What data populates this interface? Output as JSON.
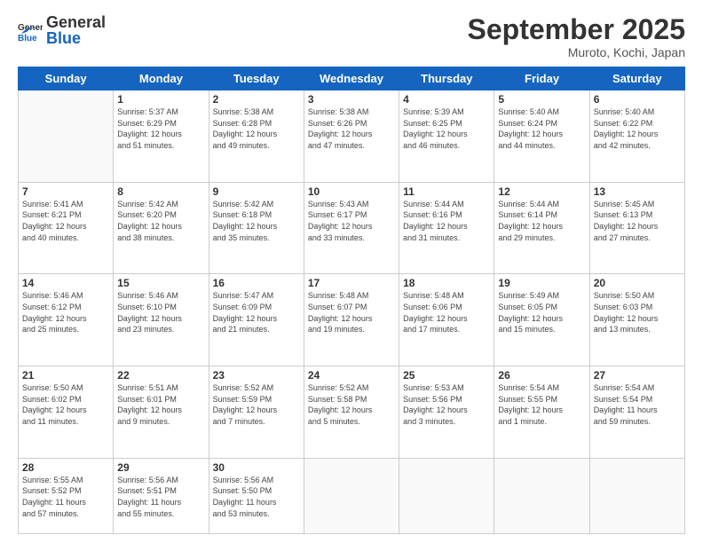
{
  "header": {
    "logo_general": "General",
    "logo_blue": "Blue",
    "month_title": "September 2025",
    "location": "Muroto, Kochi, Japan"
  },
  "weekdays": [
    "Sunday",
    "Monday",
    "Tuesday",
    "Wednesday",
    "Thursday",
    "Friday",
    "Saturday"
  ],
  "weeks": [
    [
      {
        "day": "",
        "info": ""
      },
      {
        "day": "1",
        "info": "Sunrise: 5:37 AM\nSunset: 6:29 PM\nDaylight: 12 hours\nand 51 minutes."
      },
      {
        "day": "2",
        "info": "Sunrise: 5:38 AM\nSunset: 6:28 PM\nDaylight: 12 hours\nand 49 minutes."
      },
      {
        "day": "3",
        "info": "Sunrise: 5:38 AM\nSunset: 6:26 PM\nDaylight: 12 hours\nand 47 minutes."
      },
      {
        "day": "4",
        "info": "Sunrise: 5:39 AM\nSunset: 6:25 PM\nDaylight: 12 hours\nand 46 minutes."
      },
      {
        "day": "5",
        "info": "Sunrise: 5:40 AM\nSunset: 6:24 PM\nDaylight: 12 hours\nand 44 minutes."
      },
      {
        "day": "6",
        "info": "Sunrise: 5:40 AM\nSunset: 6:22 PM\nDaylight: 12 hours\nand 42 minutes."
      }
    ],
    [
      {
        "day": "7",
        "info": "Sunrise: 5:41 AM\nSunset: 6:21 PM\nDaylight: 12 hours\nand 40 minutes."
      },
      {
        "day": "8",
        "info": "Sunrise: 5:42 AM\nSunset: 6:20 PM\nDaylight: 12 hours\nand 38 minutes."
      },
      {
        "day": "9",
        "info": "Sunrise: 5:42 AM\nSunset: 6:18 PM\nDaylight: 12 hours\nand 35 minutes."
      },
      {
        "day": "10",
        "info": "Sunrise: 5:43 AM\nSunset: 6:17 PM\nDaylight: 12 hours\nand 33 minutes."
      },
      {
        "day": "11",
        "info": "Sunrise: 5:44 AM\nSunset: 6:16 PM\nDaylight: 12 hours\nand 31 minutes."
      },
      {
        "day": "12",
        "info": "Sunrise: 5:44 AM\nSunset: 6:14 PM\nDaylight: 12 hours\nand 29 minutes."
      },
      {
        "day": "13",
        "info": "Sunrise: 5:45 AM\nSunset: 6:13 PM\nDaylight: 12 hours\nand 27 minutes."
      }
    ],
    [
      {
        "day": "14",
        "info": "Sunrise: 5:46 AM\nSunset: 6:12 PM\nDaylight: 12 hours\nand 25 minutes."
      },
      {
        "day": "15",
        "info": "Sunrise: 5:46 AM\nSunset: 6:10 PM\nDaylight: 12 hours\nand 23 minutes."
      },
      {
        "day": "16",
        "info": "Sunrise: 5:47 AM\nSunset: 6:09 PM\nDaylight: 12 hours\nand 21 minutes."
      },
      {
        "day": "17",
        "info": "Sunrise: 5:48 AM\nSunset: 6:07 PM\nDaylight: 12 hours\nand 19 minutes."
      },
      {
        "day": "18",
        "info": "Sunrise: 5:48 AM\nSunset: 6:06 PM\nDaylight: 12 hours\nand 17 minutes."
      },
      {
        "day": "19",
        "info": "Sunrise: 5:49 AM\nSunset: 6:05 PM\nDaylight: 12 hours\nand 15 minutes."
      },
      {
        "day": "20",
        "info": "Sunrise: 5:50 AM\nSunset: 6:03 PM\nDaylight: 12 hours\nand 13 minutes."
      }
    ],
    [
      {
        "day": "21",
        "info": "Sunrise: 5:50 AM\nSunset: 6:02 PM\nDaylight: 12 hours\nand 11 minutes."
      },
      {
        "day": "22",
        "info": "Sunrise: 5:51 AM\nSunset: 6:01 PM\nDaylight: 12 hours\nand 9 minutes."
      },
      {
        "day": "23",
        "info": "Sunrise: 5:52 AM\nSunset: 5:59 PM\nDaylight: 12 hours\nand 7 minutes."
      },
      {
        "day": "24",
        "info": "Sunrise: 5:52 AM\nSunset: 5:58 PM\nDaylight: 12 hours\nand 5 minutes."
      },
      {
        "day": "25",
        "info": "Sunrise: 5:53 AM\nSunset: 5:56 PM\nDaylight: 12 hours\nand 3 minutes."
      },
      {
        "day": "26",
        "info": "Sunrise: 5:54 AM\nSunset: 5:55 PM\nDaylight: 12 hours\nand 1 minute."
      },
      {
        "day": "27",
        "info": "Sunrise: 5:54 AM\nSunset: 5:54 PM\nDaylight: 11 hours\nand 59 minutes."
      }
    ],
    [
      {
        "day": "28",
        "info": "Sunrise: 5:55 AM\nSunset: 5:52 PM\nDaylight: 11 hours\nand 57 minutes."
      },
      {
        "day": "29",
        "info": "Sunrise: 5:56 AM\nSunset: 5:51 PM\nDaylight: 11 hours\nand 55 minutes."
      },
      {
        "day": "30",
        "info": "Sunrise: 5:56 AM\nSunset: 5:50 PM\nDaylight: 11 hours\nand 53 minutes."
      },
      {
        "day": "",
        "info": ""
      },
      {
        "day": "",
        "info": ""
      },
      {
        "day": "",
        "info": ""
      },
      {
        "day": "",
        "info": ""
      }
    ]
  ]
}
